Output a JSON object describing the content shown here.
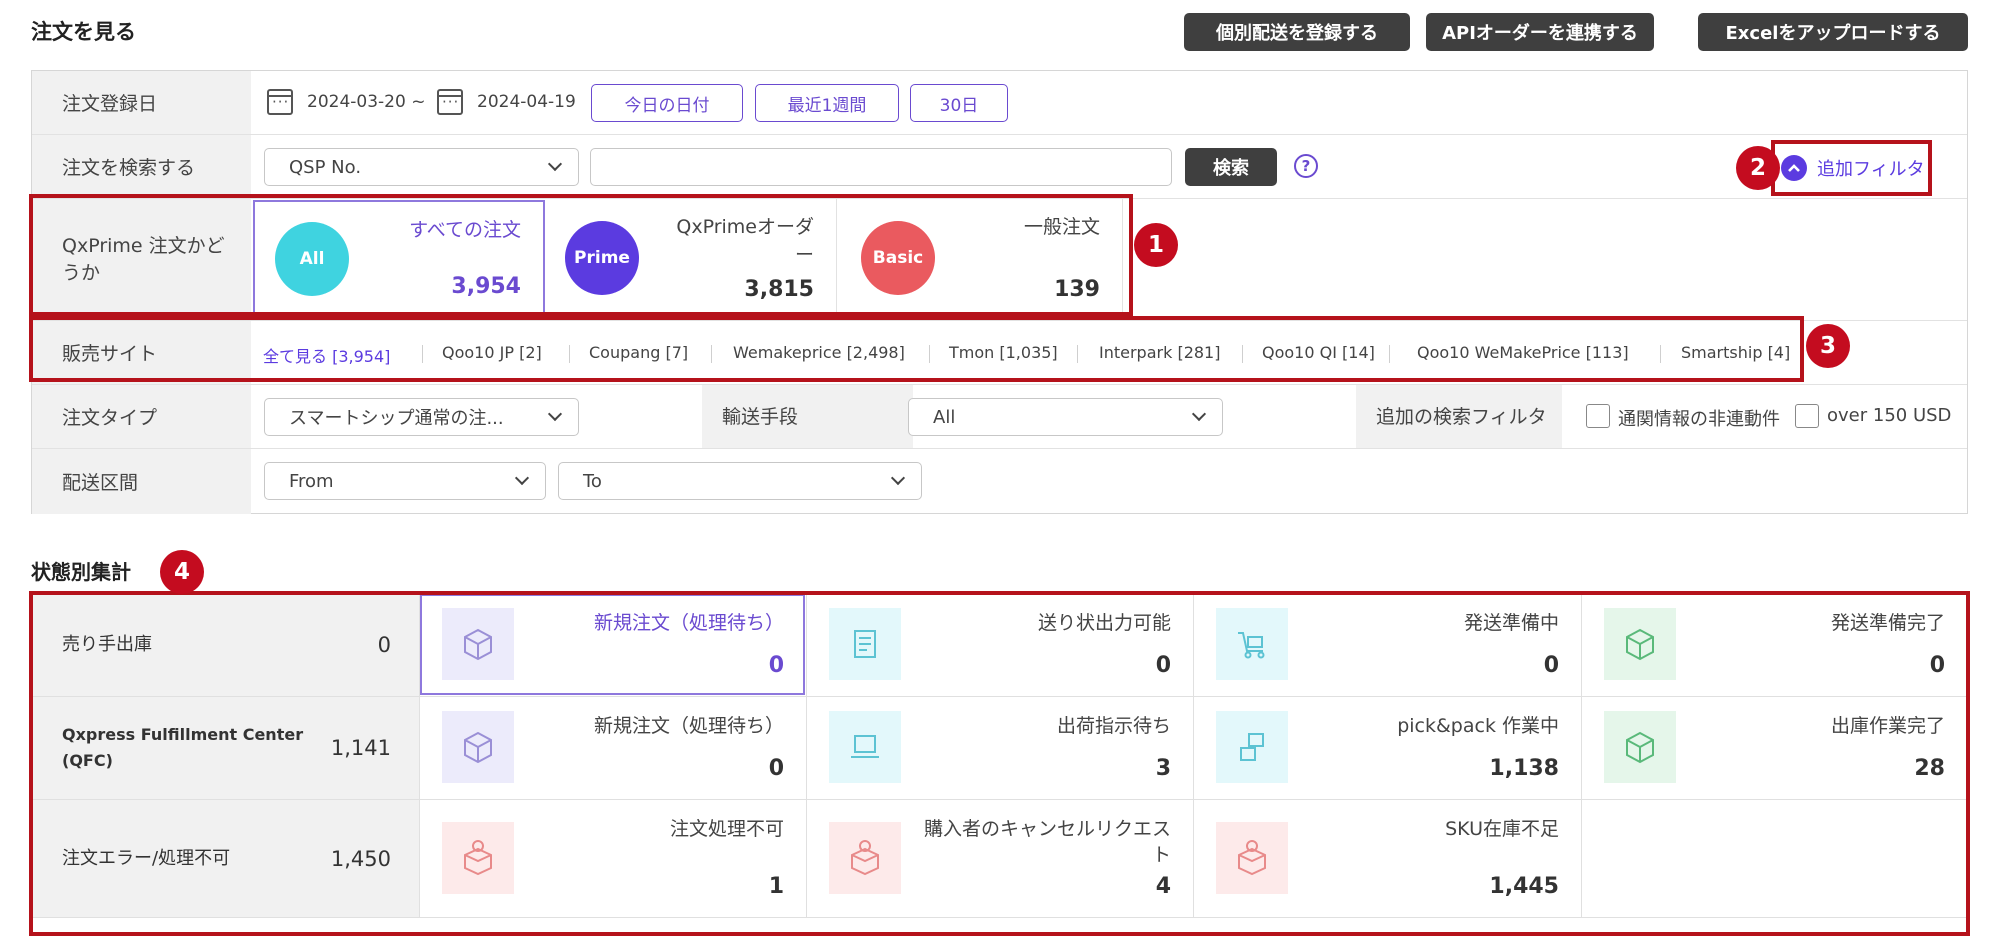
{
  "header": {
    "title": "注文を見る",
    "buttons": [
      "個別配送を登録する",
      "APIオーダーを連携する",
      "Excelをアップロードする"
    ]
  },
  "filters": {
    "order_date": {
      "label": "注文登録日",
      "start": "2024-03-20 ~",
      "end": "2024-04-19",
      "quick_buttons": [
        "今日の日付",
        "最近1週間",
        "30日"
      ]
    },
    "order_search": {
      "label": "注文を検索する",
      "select_value": "QSP No.",
      "input_value": "",
      "search_button": "検索",
      "help": "?",
      "additional_filter": "追加フィルタ"
    },
    "qxprime": {
      "label": "QxPrime 注文かどうか",
      "cards": [
        {
          "badge": "All",
          "label": "すべての注文",
          "count": "3,954",
          "color": "#3fd3e0"
        },
        {
          "badge": "Prime",
          "label": "QxPrimeオーダー",
          "count": "3,815",
          "color": "#5b3be0"
        },
        {
          "badge": "Basic",
          "label": "一般注文",
          "count": "139",
          "color": "#ea5a5f"
        }
      ]
    },
    "sales_site": {
      "label": "販売サイト",
      "sites": [
        "全て見る [3,954]",
        "Qoo10 JP [2]",
        "Coupang [7]",
        "Wemakeprice [2,498]",
        "Tmon [1,035]",
        "Interpark [281]",
        "Qoo10 QI [14]",
        "Qoo10 WeMakePrice [113]",
        "Smartship [4]"
      ]
    },
    "order_type": {
      "label": "注文タイプ",
      "select_value": "スマートシップ通常の注...",
      "transport_label": "輸送手段",
      "transport_value": "All",
      "extra_label": "追加の検索フィルタ",
      "checkbox1": "通関情報の非連動件",
      "checkbox2": "over 150 USD"
    },
    "delivery": {
      "label": "配送区間",
      "from": "From",
      "to": "To"
    }
  },
  "markers": [
    "1",
    "2",
    "3",
    "4"
  ],
  "summary": {
    "title": "状態別集計",
    "rows": [
      {
        "label": "売り手出庫",
        "count": "0",
        "cells": [
          {
            "label": "新規注文（処理待ち）",
            "count": "0",
            "icon": "box-icon",
            "tint": "#ecebfb"
          },
          {
            "label": "送り状出力可能",
            "count": "0",
            "icon": "invoice-icon",
            "tint": "#e3f8fb"
          },
          {
            "label": "発送準備中",
            "count": "0",
            "icon": "cart-icon",
            "tint": "#e3f8fb"
          },
          {
            "label": "発送準備完了",
            "count": "0",
            "icon": "box-check-icon",
            "tint": "#e5f6ea"
          }
        ]
      },
      {
        "label": "Qxpress Fulfillment Center (QFC)",
        "count": "1,141",
        "cells": [
          {
            "label": "新規注文（処理待ち）",
            "count": "0",
            "icon": "box-icon",
            "tint": "#ecebfb"
          },
          {
            "label": "出荷指示待ち",
            "count": "3",
            "icon": "laptop-icon",
            "tint": "#e3f8fb"
          },
          {
            "label": "pick&pack 作業中",
            "count": "1,138",
            "icon": "packing-icon",
            "tint": "#e3f8fb"
          },
          {
            "label": "出庫作業完了",
            "count": "28",
            "icon": "box-check-icon",
            "tint": "#e5f6ea"
          }
        ]
      },
      {
        "label": "注文エラー/処理不可",
        "count": "1,450",
        "cells": [
          {
            "label": "注文処理不可",
            "count": "1",
            "icon": "box-error-icon",
            "tint": "#fdeaea"
          },
          {
            "label": "購入者のキャンセルリクエスト",
            "count": "4",
            "icon": "box-error-icon",
            "tint": "#fdeaea"
          },
          {
            "label": "SKU在庫不足",
            "count": "1,445",
            "icon": "box-error-icon",
            "tint": "#fdeaea"
          }
        ]
      }
    ]
  },
  "colors": {
    "accent": "#6a4ad0",
    "marker": "#c40c1f",
    "dark_button": "#3f3f3f"
  }
}
